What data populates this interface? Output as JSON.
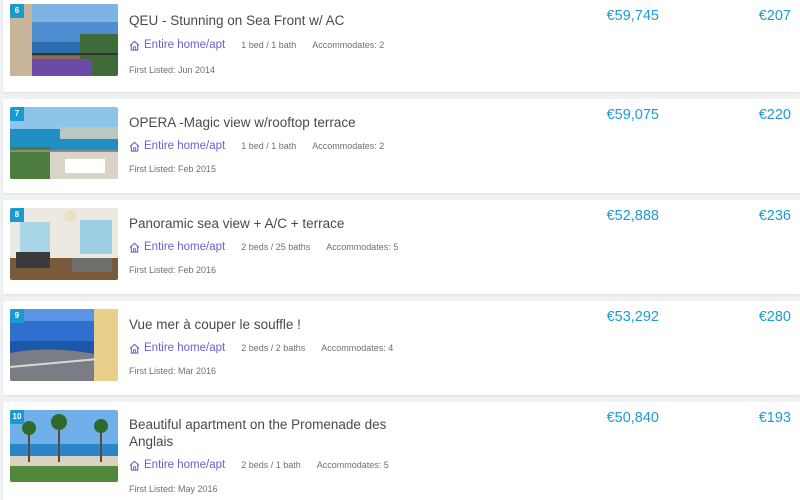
{
  "colors": {
    "price": "#1c9ad6",
    "room_type": "#6b5fd2",
    "rank_badge": "#1a9bd0"
  },
  "listings": [
    {
      "rank": "6",
      "title": "QEU - Stunning on Sea Front w/ AC",
      "room_type": "Entire home/apt",
      "room_icon": "home-icon",
      "beds": "1 bed / 1 bath",
      "accommodates": "Accommodates: 2",
      "first_listed": "First Listed: Jun 2014",
      "revenue": "€59,745",
      "rate": "€207"
    },
    {
      "rank": "7",
      "title": "OPERA -Magic view w/rooftop terrace",
      "room_type": "Entire home/apt",
      "room_icon": "home-icon",
      "beds": "1 bed / 1 bath",
      "accommodates": "Accommodates: 2",
      "first_listed": "First Listed: Feb 2015",
      "revenue": "€59,075",
      "rate": "€220"
    },
    {
      "rank": "8",
      "title": "Panoramic sea view + A/C + terrace",
      "room_type": "Entire home/apt",
      "room_icon": "home-icon",
      "beds": "2 beds / 25 baths",
      "accommodates": "Accommodates: 5",
      "first_listed": "First Listed: Feb 2016",
      "revenue": "€52,888",
      "rate": "€236"
    },
    {
      "rank": "9",
      "title": "Vue mer à couper le souffle !",
      "room_type": "Entire home/apt",
      "room_icon": "home-icon",
      "beds": "2 beds / 2 baths",
      "accommodates": "Accommodates: 4",
      "first_listed": "First Listed: Mar 2016",
      "revenue": "€53,292",
      "rate": "€280"
    },
    {
      "rank": "10",
      "title": "Beautiful apartment on the Promenade des Anglais",
      "room_type": "Entire home/apt",
      "room_icon": "home-icon",
      "beds": "2 beds / 1 bath",
      "accommodates": "Accommodates: 5",
      "first_listed": "First Listed: May 2016",
      "revenue": "€50,840",
      "rate": "€193"
    }
  ]
}
